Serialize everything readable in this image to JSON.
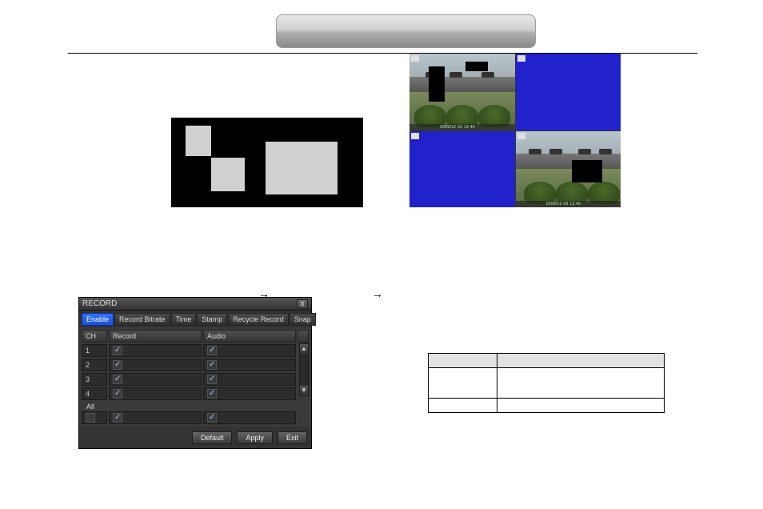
{
  "header": {
    "title": ""
  },
  "quad": {
    "panes": [
      {
        "timestamp": "2009/12 09 13:40"
      },
      {
        "timestamp": ""
      },
      {
        "timestamp": ""
      },
      {
        "timestamp": "2009/12 09 13:40"
      }
    ]
  },
  "breadcrumb": {
    "arrow": "→",
    "sep": "  "
  },
  "record_window": {
    "title": "RECORD",
    "close": "X",
    "tabs": {
      "enable": "Enable",
      "bitrate": "Record Bitrate",
      "time": "Time",
      "stamp": "Stamp",
      "recycle": "Recycle Record",
      "snap": "Snap"
    },
    "headers": {
      "ch": "CH",
      "record": "Record",
      "audio": "Audio"
    },
    "rows": [
      {
        "ch": "1",
        "record": true,
        "audio": true
      },
      {
        "ch": "2",
        "record": true,
        "audio": true
      },
      {
        "ch": "3",
        "record": true,
        "audio": true
      },
      {
        "ch": "4",
        "record": true,
        "audio": true
      }
    ],
    "all_label": "All",
    "all_row": {
      "master": false,
      "record": true,
      "audio": true
    },
    "buttons": {
      "default": "Default",
      "apply": "Apply",
      "exit": "Exit"
    },
    "scroll": {
      "up": "▲",
      "down": "▼"
    }
  },
  "param_table": {
    "head": {
      "c1": "",
      "c2": ""
    },
    "rows": [
      {
        "c1": "",
        "c2": ""
      },
      {
        "c1": "",
        "c2": ""
      }
    ]
  }
}
